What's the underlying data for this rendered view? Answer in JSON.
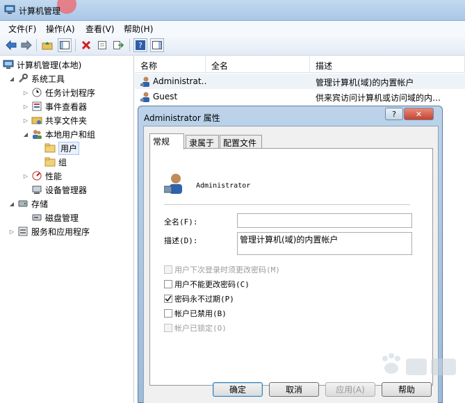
{
  "window": {
    "title": "计算机管理"
  },
  "menu": [
    "文件(F)",
    "操作(A)",
    "查看(V)",
    "帮助(H)"
  ],
  "toolbar": {
    "buttons": [
      "back-icon",
      "forward-icon",
      "up-folder-icon",
      "show-hide-tree-icon",
      "delete-icon",
      "properties-icon",
      "export-list-icon",
      "help-icon",
      "action-pane-icon"
    ]
  },
  "tree": {
    "items": [
      {
        "label": "计算机管理(本地)",
        "icon": "computer-icon"
      },
      {
        "label": "系统工具",
        "icon": "tools-icon"
      },
      {
        "label": "任务计划程序",
        "icon": "clock-icon"
      },
      {
        "label": "事件查看器",
        "icon": "event-viewer-icon"
      },
      {
        "label": "共享文件夹",
        "icon": "shared-folder-icon"
      },
      {
        "label": "本地用户和组",
        "icon": "users-icon"
      },
      {
        "label": "用户",
        "icon": "folder-icon"
      },
      {
        "label": "组",
        "icon": "folder-icon"
      },
      {
        "label": "性能",
        "icon": "performance-icon"
      },
      {
        "label": "设备管理器",
        "icon": "device-manager-icon"
      },
      {
        "label": "存储",
        "icon": "storage-icon"
      },
      {
        "label": "磁盘管理",
        "icon": "disk-icon"
      },
      {
        "label": "服务和应用程序",
        "icon": "services-icon"
      }
    ]
  },
  "list": {
    "columns": [
      "名称",
      "全名",
      "描述"
    ],
    "rows": [
      {
        "name": "Administrat…",
        "fullname": "",
        "description": "管理计算机(域)的内置帐户"
      },
      {
        "name": "Guest",
        "fullname": "",
        "description": "供来宾访问计算机或访问域的内…"
      }
    ]
  },
  "dialog": {
    "title": "Administrator 属性",
    "help_button": "?",
    "close_button": "✕",
    "tabs": [
      "常规",
      "隶属于",
      "配置文件"
    ],
    "active_tab": "常规",
    "username": "Administrator",
    "fullname_label": "全名(F):",
    "fullname_value": "",
    "description_label": "描述(D):",
    "description_value": "管理计算机(域)的内置帐户",
    "checkboxes": [
      {
        "label": "用户下次登录时须更改密码(M)",
        "checked": false,
        "enabled": false
      },
      {
        "label": "用户不能更改密码(C)",
        "checked": false,
        "enabled": true
      },
      {
        "label": "密码永不过期(P)",
        "checked": true,
        "enabled": true
      },
      {
        "label": "帐户已禁用(B)",
        "checked": false,
        "enabled": true
      },
      {
        "label": "帐户已锁定(O)",
        "checked": false,
        "enabled": false
      }
    ],
    "buttons": {
      "ok": "确定",
      "cancel": "取消",
      "apply": "应用(A)",
      "help": "帮助"
    }
  },
  "colors": {
    "title_bar": "#b6d0ec",
    "selection": "#e8f1fc",
    "default_button_border": "#3c7fb1"
  }
}
